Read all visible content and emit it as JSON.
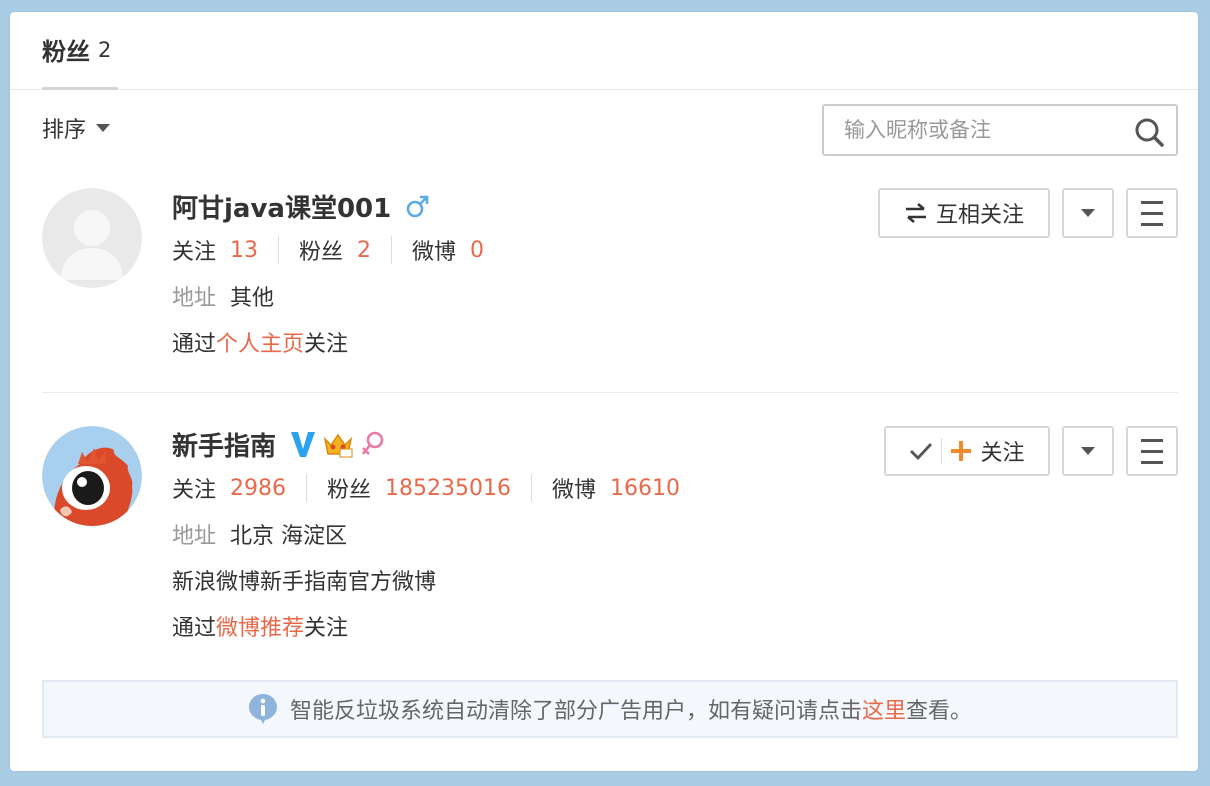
{
  "tab": {
    "title": "粉丝",
    "count": "2"
  },
  "toolbar": {
    "sort_label": "排序",
    "search_placeholder": "输入昵称或备注"
  },
  "users": [
    {
      "name": "阿甘java课堂001",
      "gender_icon": "male-icon",
      "stats": [
        {
          "label": "关注",
          "value": "13"
        },
        {
          "label": "粉丝",
          "value": "2"
        },
        {
          "label": "微博",
          "value": "0"
        }
      ],
      "address_label": "地址",
      "address": "其他",
      "via_prefix": "通过",
      "via_link": "个人主页",
      "via_suffix": "关注",
      "button": "互相关注"
    },
    {
      "name": "新手指南",
      "badges": [
        "verified-v-icon",
        "crown-icon",
        "female-icon"
      ],
      "stats": [
        {
          "label": "关注",
          "value": "2986"
        },
        {
          "label": "粉丝",
          "value": "185235016"
        },
        {
          "label": "微博",
          "value": "16610"
        }
      ],
      "address_label": "地址",
      "address": "北京 海淀区",
      "description": "新浪微博新手指南官方微博",
      "via_prefix": "通过",
      "via_link": "微博推荐",
      "via_suffix": "关注",
      "button": "关注"
    }
  ],
  "notice": {
    "text": "智能反垃圾系统自动清除了部分广告用户，如有疑问请点击",
    "link": "这里",
    "suffix": "查看。"
  },
  "colors": {
    "accent": "#e8694a",
    "verified": "#2aa2f0",
    "male": "#5aabe6",
    "female": "#e97aa6"
  }
}
